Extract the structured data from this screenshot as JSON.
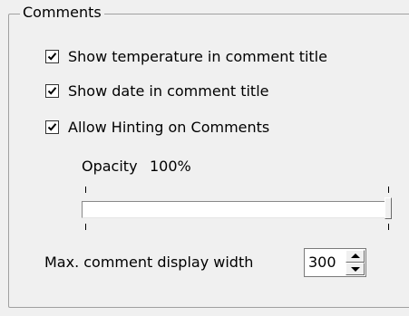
{
  "comments_group": {
    "title": "Comments",
    "checkboxes": [
      {
        "label": "Show temperature in comment title",
        "checked": true
      },
      {
        "label": "Show date in comment title",
        "checked": true
      },
      {
        "label": "Allow Hinting on Comments",
        "checked": true
      }
    ],
    "opacity": {
      "label": "Opacity",
      "value_text": "100%",
      "value": 1.0
    },
    "max_width": {
      "label": "Max. comment display width",
      "value": "300"
    }
  },
  "colors": {
    "window_bg": "#f0f0f0",
    "border": "#a0a0a0",
    "field_bg": "#ffffff"
  },
  "icons": {
    "checkmark": "checkmark-icon",
    "spin_up": "up-arrow-icon",
    "spin_down": "down-arrow-icon"
  }
}
